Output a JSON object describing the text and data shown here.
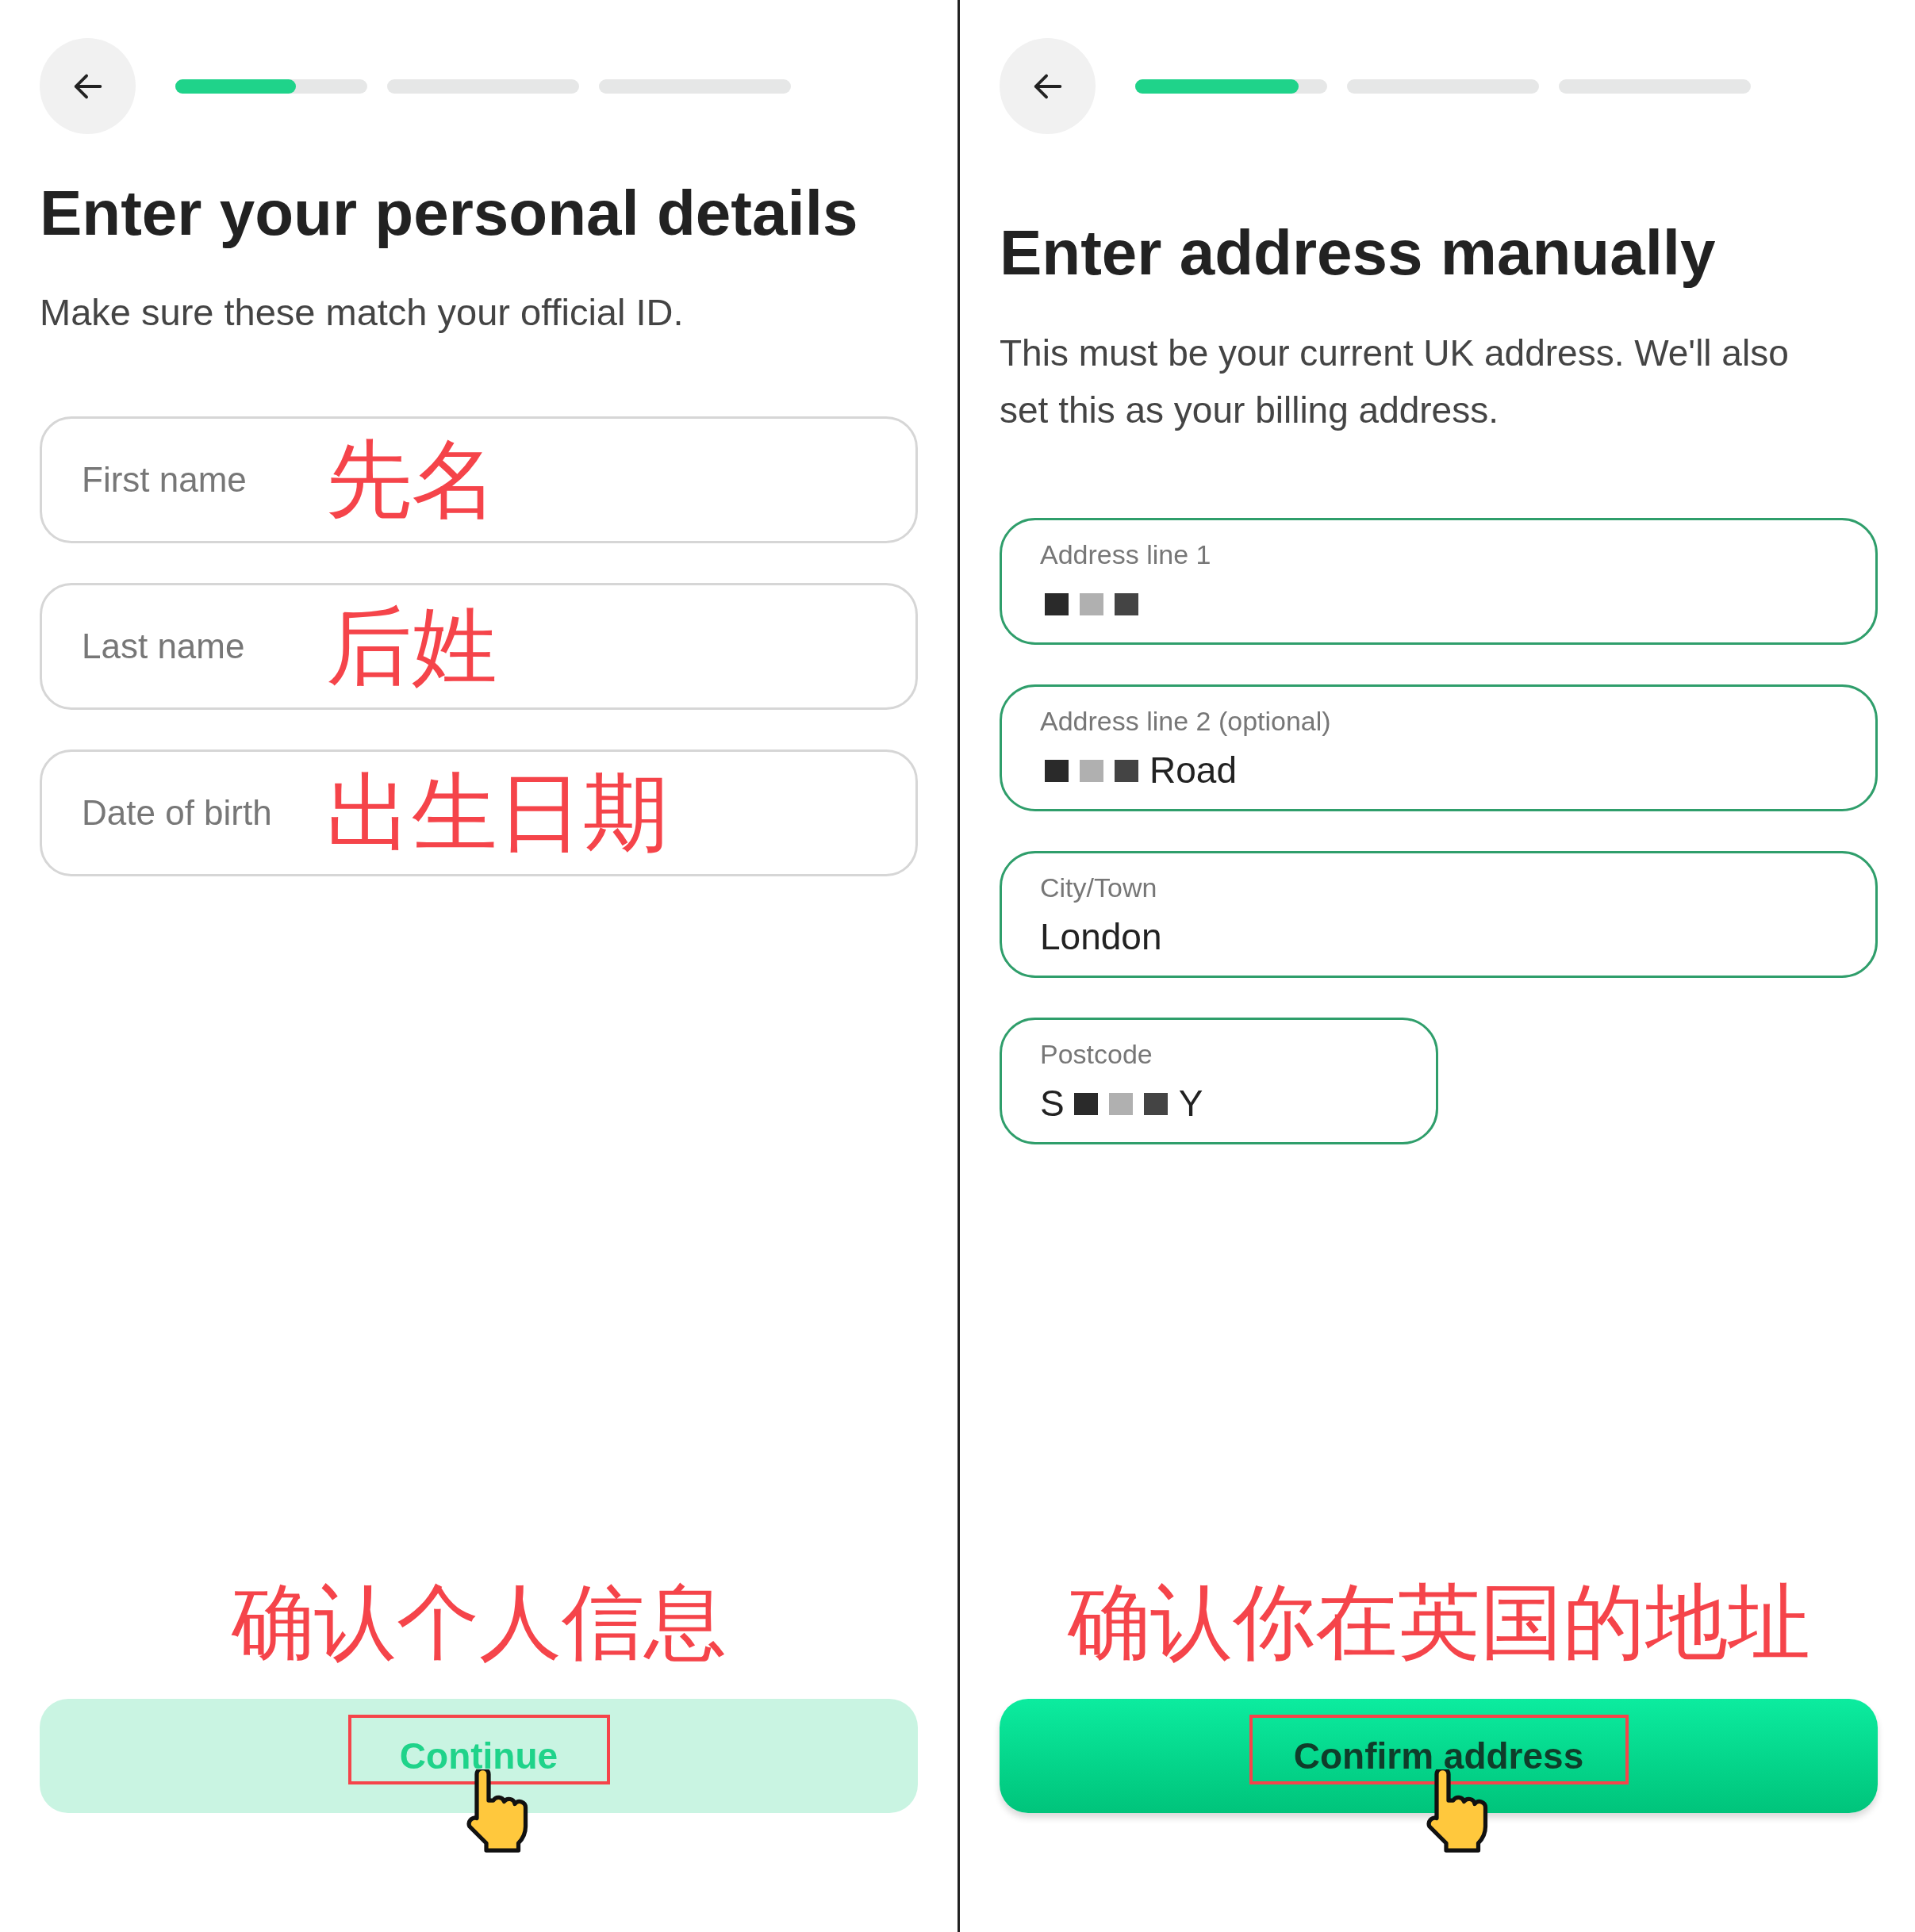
{
  "screens": [
    {
      "progress": {
        "level": 0.63
      },
      "title": "Enter your personal details",
      "subtitle": "Make sure these match your official ID.",
      "fields": [
        {
          "kind": "inline",
          "label": "First name",
          "annotation": "先名"
        },
        {
          "kind": "inline",
          "label": "Last name",
          "annotation": "后姓"
        },
        {
          "kind": "inline",
          "label": "Date of birth",
          "annotation": "出生日期"
        }
      ],
      "button": {
        "label": "Continue",
        "disabled": true
      },
      "annotation": "确认个人信息"
    },
    {
      "progress": {
        "level": 0.85
      },
      "title": "Enter address manually",
      "subtitle": "This must be your current UK address. We'll also set this as your billing address.",
      "fields": [
        {
          "kind": "floating",
          "label": "Address line 1",
          "value_parts": [
            {
              "kind": "redacted"
            }
          ],
          "wide": true
        },
        {
          "kind": "floating",
          "label": "Address line 2 (optional)",
          "value_parts": [
            {
              "kind": "redacted"
            },
            {
              "kind": "text",
              "text": "Road"
            }
          ],
          "wide": true
        },
        {
          "kind": "floating",
          "label": "City/Town",
          "value_parts": [
            {
              "kind": "text",
              "text": "London"
            }
          ],
          "wide": true
        },
        {
          "kind": "floating",
          "label": "Postcode",
          "value_parts": [
            {
              "kind": "text",
              "text": "S"
            },
            {
              "kind": "redacted"
            },
            {
              "kind": "text",
              "text": "Y"
            }
          ],
          "wide": false
        }
      ],
      "button": {
        "label": "Confirm address",
        "disabled": false
      },
      "annotation": "确认你在英国的地址"
    }
  ]
}
